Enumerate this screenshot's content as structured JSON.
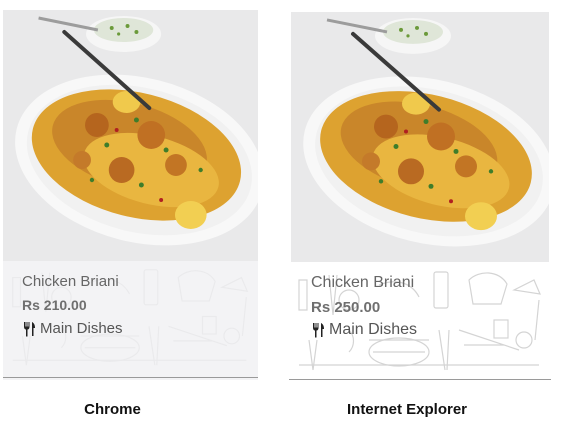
{
  "cards": [
    {
      "title": "Chicken Briani",
      "price": "Rs 210.00",
      "category": "Main Dishes",
      "category_icon": "fork-knife-icon"
    },
    {
      "title": "Chicken Briani",
      "price": "Rs 250.00",
      "category": "Main Dishes",
      "category_icon": "fork-knife-icon"
    }
  ],
  "captions": [
    "Chrome",
    "Internet Explorer"
  ],
  "colors": {
    "rice": "#e0a62c",
    "plate": "#ffffff",
    "info_bg": "#f0f0f2",
    "caption": "#111111"
  }
}
